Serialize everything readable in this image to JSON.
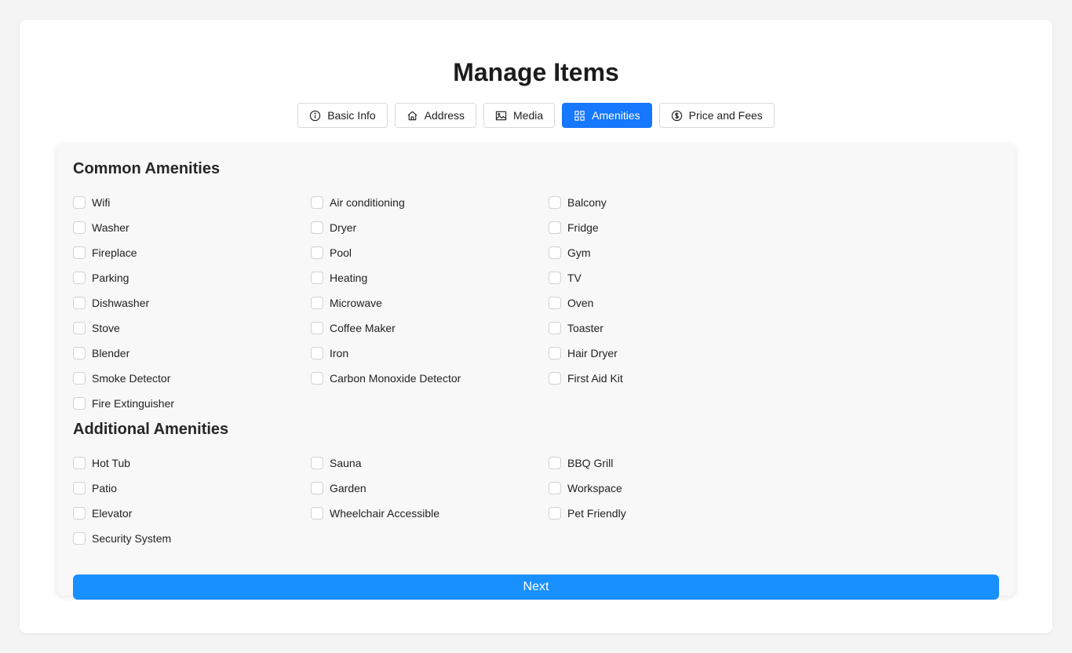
{
  "page_title": "Manage Items",
  "tabs": [
    {
      "label": "Basic Info",
      "icon": "info-circle-icon",
      "active": false
    },
    {
      "label": "Address",
      "icon": "home-icon",
      "active": false
    },
    {
      "label": "Media",
      "icon": "image-icon",
      "active": false
    },
    {
      "label": "Amenities",
      "icon": "grid-icon",
      "active": true
    },
    {
      "label": "Price and Fees",
      "icon": "dollar-circle-icon",
      "active": false
    }
  ],
  "colors": {
    "accent": "#1677ff",
    "next_button": "#1890ff"
  },
  "common": {
    "title": "Common Amenities",
    "items": [
      "Wifi",
      "Air conditioning",
      "Balcony",
      "Washer",
      "Dryer",
      "Fridge",
      "Fireplace",
      "Pool",
      "Gym",
      "Parking",
      "Heating",
      "TV",
      "Dishwasher",
      "Microwave",
      "Oven",
      "Stove",
      "Coffee Maker",
      "Toaster",
      "Blender",
      "Iron",
      "Hair Dryer",
      "Smoke Detector",
      "Carbon Monoxide Detector",
      "First Aid Kit",
      "Fire Extinguisher"
    ]
  },
  "additional": {
    "title": "Additional Amenities",
    "items": [
      "Hot Tub",
      "Sauna",
      "BBQ Grill",
      "Patio",
      "Garden",
      "Workspace",
      "Elevator",
      "Wheelchair Accessible",
      "Pet Friendly",
      "Security System"
    ]
  },
  "next_label": "Next"
}
